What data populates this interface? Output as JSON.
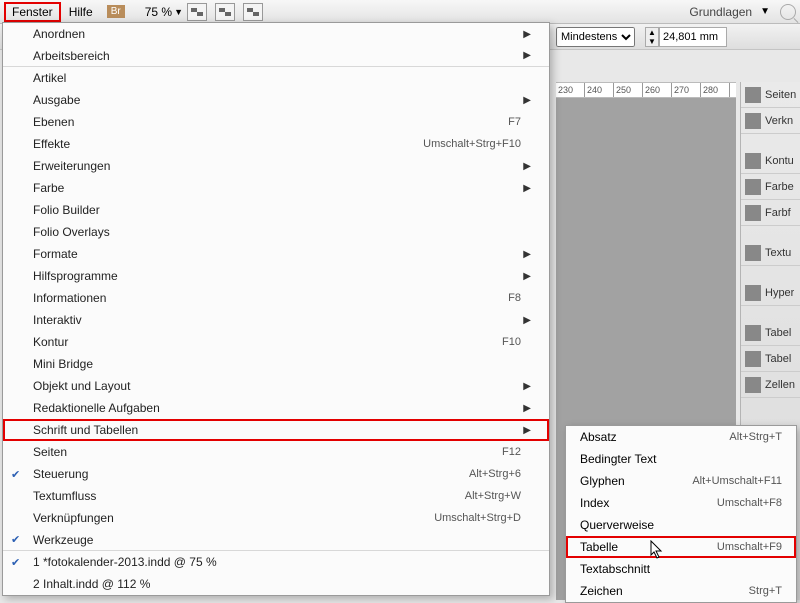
{
  "topbar": {
    "fenster": "Fenster",
    "hilfe": "Hilfe",
    "br": "Br",
    "zoom": "75 %",
    "grundlagen": "Grundlagen"
  },
  "secondbar": {
    "dropdown_value": "Mindestens",
    "num_value": "24,801 mm"
  },
  "ruler": {
    "ticks": [
      "230",
      "240",
      "250",
      "260",
      "270",
      "280"
    ]
  },
  "panels": [
    {
      "label": "Seiten"
    },
    {
      "label": "Verkn"
    },
    {
      "gap": true
    },
    {
      "label": "Kontu"
    },
    {
      "label": "Farbe"
    },
    {
      "label": "Farbf"
    },
    {
      "gap": true
    },
    {
      "label": "Textu"
    },
    {
      "gap": true
    },
    {
      "label": "Hyper"
    },
    {
      "gap": true
    },
    {
      "label": "Tabel"
    },
    {
      "label": "Tabel"
    },
    {
      "label": "Zellen"
    }
  ],
  "menu": [
    {
      "label": "Anordnen",
      "arrow": true
    },
    {
      "label": "Arbeitsbereich",
      "arrow": true,
      "sep": true
    },
    {
      "label": "Artikel"
    },
    {
      "label": "Ausgabe",
      "arrow": true
    },
    {
      "label": "Ebenen",
      "shortcut": "F7"
    },
    {
      "label": "Effekte",
      "shortcut": "Umschalt+Strg+F10"
    },
    {
      "label": "Erweiterungen",
      "arrow": true
    },
    {
      "label": "Farbe",
      "arrow": true
    },
    {
      "label": "Folio Builder"
    },
    {
      "label": "Folio Overlays"
    },
    {
      "label": "Formate",
      "arrow": true
    },
    {
      "label": "Hilfsprogramme",
      "arrow": true
    },
    {
      "label": "Informationen",
      "shortcut": "F8"
    },
    {
      "label": "Interaktiv",
      "arrow": true
    },
    {
      "label": "Kontur",
      "shortcut": "F10"
    },
    {
      "label": "Mini Bridge"
    },
    {
      "label": "Objekt und Layout",
      "arrow": true
    },
    {
      "label": "Redaktionelle Aufgaben",
      "arrow": true
    },
    {
      "label": "Schrift und Tabellen",
      "arrow": true,
      "highlighted": true
    },
    {
      "label": "Seiten",
      "shortcut": "F12"
    },
    {
      "label": "Steuerung",
      "shortcut": "Alt+Strg+6",
      "checked": true
    },
    {
      "label": "Textumfluss",
      "shortcut": "Alt+Strg+W"
    },
    {
      "label": "Verknüpfungen",
      "shortcut": "Umschalt+Strg+D"
    },
    {
      "label": "Werkzeuge",
      "checked": true,
      "sep": true
    },
    {
      "label": "1 *fotokalender-2013.indd @ 75 %",
      "checked": true
    },
    {
      "label": "2 Inhalt.indd @ 112 %"
    }
  ],
  "submenu": [
    {
      "label": "Absatz",
      "shortcut": "Alt+Strg+T"
    },
    {
      "label": "Bedingter Text"
    },
    {
      "label": "Glyphen",
      "shortcut": "Alt+Umschalt+F11"
    },
    {
      "label": "Index",
      "shortcut": "Umschalt+F8"
    },
    {
      "label": "Querverweise"
    },
    {
      "label": "Tabelle",
      "shortcut": "Umschalt+F9",
      "highlighted": true
    },
    {
      "label": "Textabschnitt"
    },
    {
      "label": "Zeichen",
      "shortcut": "Strg+T"
    }
  ]
}
